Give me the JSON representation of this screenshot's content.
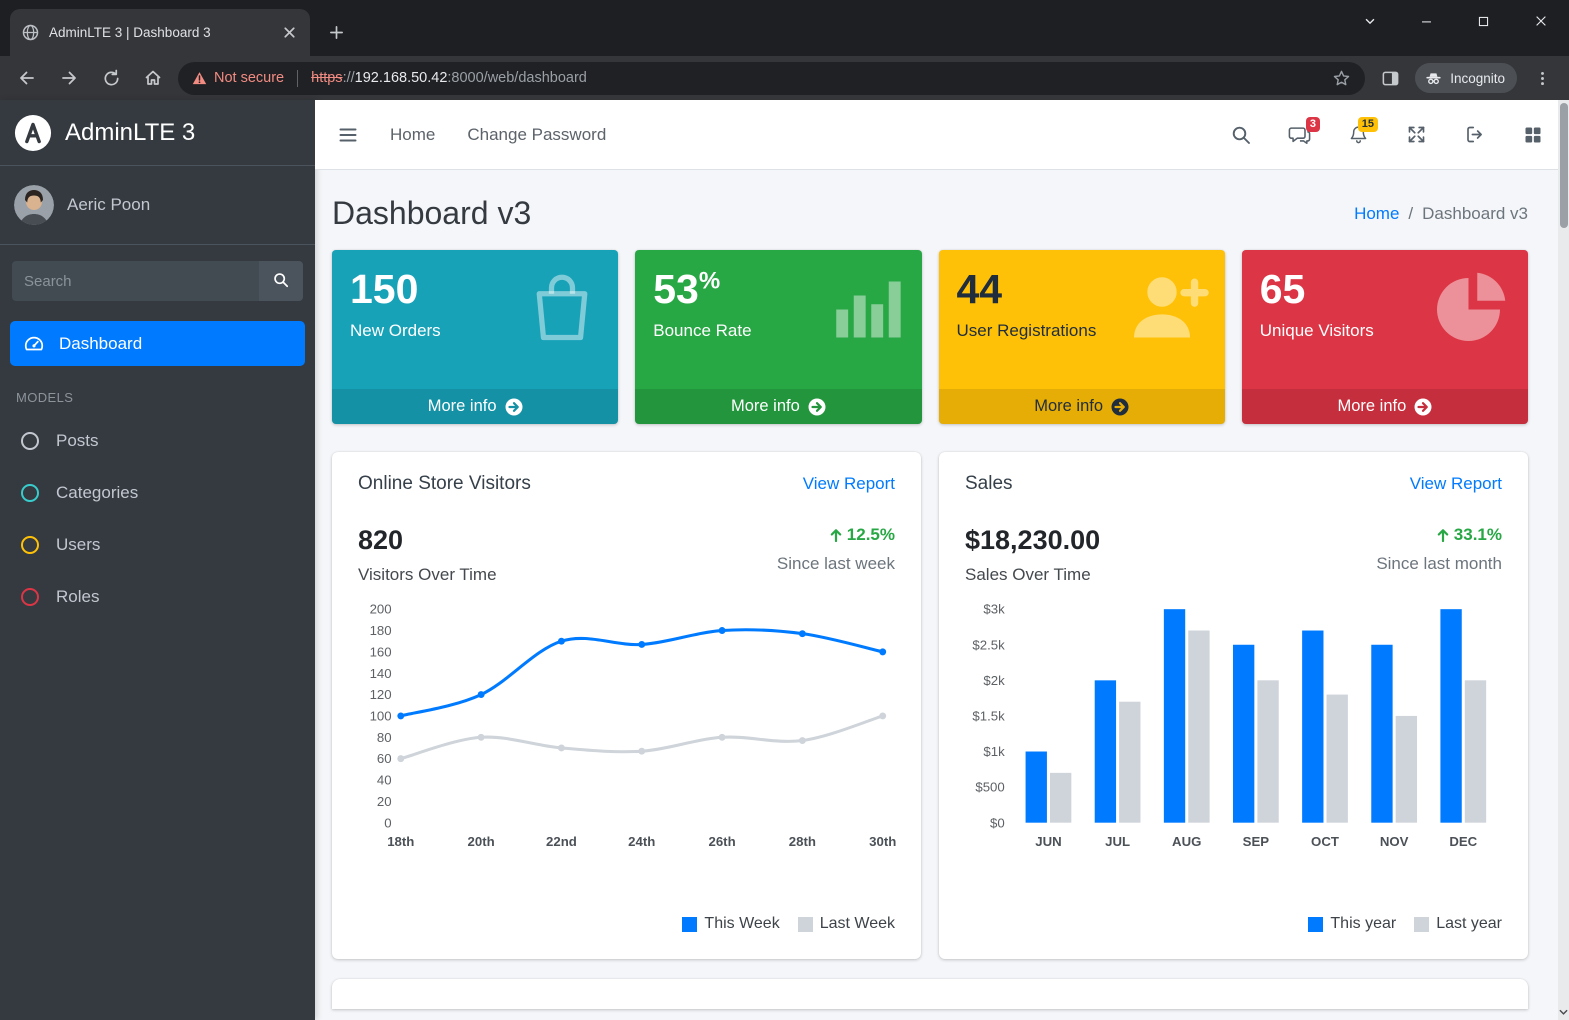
{
  "browser": {
    "tab_title": "AdminLTE 3 | Dashboard 3",
    "security_label": "Not secure",
    "url": {
      "scheme": "https",
      "separator": "://",
      "host": "192.168.50.42",
      "path": ":8000/web/dashboard"
    },
    "incognito_label": "Incognito"
  },
  "sidebar": {
    "brand": "AdminLTE 3",
    "user_name": "Aeric Poon",
    "search_placeholder": "Search",
    "dashboard_label": "Dashboard",
    "section_label": "MODELS",
    "models": [
      {
        "label": "Posts",
        "color": "#c2c7d0"
      },
      {
        "label": "Categories",
        "color": "#39cccc"
      },
      {
        "label": "Users",
        "color": "#ffc107"
      },
      {
        "label": "Roles",
        "color": "#dc3545"
      }
    ]
  },
  "navbar": {
    "home_label": "Home",
    "change_password_label": "Change Password",
    "messages_badge": "3",
    "notifications_badge": "15"
  },
  "page": {
    "title": "Dashboard v3",
    "breadcrumb_home": "Home",
    "breadcrumb_sep": "/",
    "breadcrumb_current": "Dashboard v3"
  },
  "colors": {
    "accent": "#007bff",
    "success": "#28a745",
    "gray_series": "#ced4da"
  },
  "small_boxes": [
    {
      "value": "150",
      "sup": "",
      "label": "New Orders",
      "more": "More info",
      "color": "#17a2b8",
      "text": "#ffffff"
    },
    {
      "value": "53",
      "sup": "%",
      "label": "Bounce Rate",
      "more": "More info",
      "color": "#28a745",
      "text": "#ffffff"
    },
    {
      "value": "44",
      "sup": "",
      "label": "User Registrations",
      "more": "More info",
      "color": "#ffc107",
      "text": "#1f2d3d"
    },
    {
      "value": "65",
      "sup": "",
      "label": "Unique Visitors",
      "more": "More info",
      "color": "#dc3545",
      "text": "#ffffff"
    }
  ],
  "visitors_card": {
    "title": "Online Store Visitors",
    "link": "View Report",
    "value": "820",
    "value_label": "Visitors Over Time",
    "delta": "12.5%",
    "delta_note": "Since last week"
  },
  "sales_card": {
    "title": "Sales",
    "link": "View Report",
    "value": "$18,230.00",
    "value_label": "Sales Over Time",
    "delta": "33.1%",
    "delta_note": "Since last month"
  },
  "chart_data": [
    {
      "type": "line",
      "title": "Online Store Visitors",
      "x": [
        "18th",
        "20th",
        "22nd",
        "24th",
        "26th",
        "28th",
        "30th"
      ],
      "series": [
        {
          "name": "This Week",
          "color": "#007bff",
          "values": [
            100,
            120,
            170,
            167,
            180,
            177,
            160
          ]
        },
        {
          "name": "Last Week",
          "color": "#ced4da",
          "values": [
            60,
            80,
            70,
            67,
            80,
            77,
            100
          ]
        }
      ],
      "ylim": [
        0,
        200
      ],
      "yticks": [
        0,
        20,
        40,
        60,
        80,
        100,
        120,
        140,
        160,
        180,
        200
      ],
      "grid": false,
      "legend_position": "bottom-right"
    },
    {
      "type": "bar",
      "title": "Sales",
      "x": [
        "JUN",
        "JUL",
        "AUG",
        "SEP",
        "OCT",
        "NOV",
        "DEC"
      ],
      "series": [
        {
          "name": "This year",
          "color": "#007bff",
          "values": [
            1000,
            2000,
            3000,
            2500,
            2700,
            2500,
            3000
          ]
        },
        {
          "name": "Last year",
          "color": "#ced4da",
          "values": [
            700,
            1700,
            2700,
            2000,
            1800,
            1500,
            2000
          ]
        }
      ],
      "ylim": [
        0,
        3000
      ],
      "yticks": [
        0,
        500,
        1000,
        1500,
        2000,
        2500,
        3000
      ],
      "ytick_labels": [
        "$0",
        "$500",
        "$1k",
        "$1.5k",
        "$2k",
        "$2.5k",
        "$3k"
      ],
      "grid": false,
      "legend_position": "bottom-right"
    }
  ]
}
